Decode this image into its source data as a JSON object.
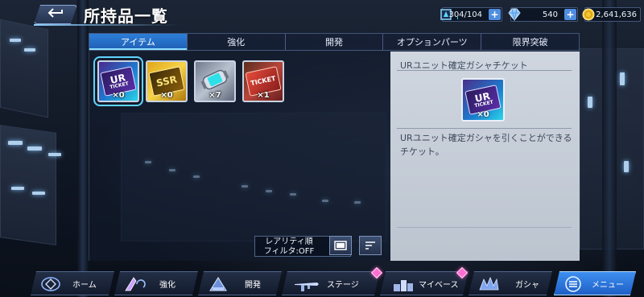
{
  "header": {
    "title": "所持品一覧",
    "back_icon": "back-arrow-icon",
    "resources": [
      {
        "name": "stamina",
        "value": "304/104",
        "icon": "stamina-icon",
        "color": "#33d7ff"
      },
      {
        "name": "gems",
        "value": "540",
        "icon": "gem-icon"
      },
      {
        "name": "coins",
        "value": "2,641,636",
        "icon": "coin-icon",
        "color": "#f4c430"
      }
    ],
    "plus_label": "+"
  },
  "tabs": [
    {
      "label": "アイテム",
      "active": true
    },
    {
      "label": "強化",
      "active": false
    },
    {
      "label": "開発",
      "active": false
    },
    {
      "label": "オプションパーツ",
      "active": false
    },
    {
      "label": "限界突破",
      "active": false
    }
  ],
  "items": [
    {
      "name": "ur-gacha-ticket",
      "count": "×0",
      "icon": "ur-ticket-icon",
      "ticket_top": "UR",
      "ticket_bottom": "TICKET",
      "selected": true
    },
    {
      "name": "ssr-gacha-ticket",
      "count": "×0",
      "icon": "ssr-ticket-icon",
      "ticket_top": "SSR",
      "ticket_bottom": "",
      "selected": false
    },
    {
      "name": "energy-canister",
      "count": "×7",
      "icon": "canister-icon",
      "selected": false
    },
    {
      "name": "gacha-ticket",
      "count": "×1",
      "icon": "ticket-icon",
      "ticket_top": "TICKET",
      "ticket_bottom": "",
      "selected": false
    }
  ],
  "sort": {
    "order_label": "レアリティ順",
    "filter_label": "フィルタ:OFF"
  },
  "detail": {
    "title": "URユニット確定ガシャチケット",
    "count": "×0",
    "ticket_top": "UR",
    "ticket_bottom": "TICKET",
    "description": "URユニット確定ガシャを引くことができるチケット。"
  },
  "bottom_nav": [
    {
      "label": "ホーム",
      "icon": "home-icon"
    },
    {
      "label": "強化",
      "icon": "upgrade-icon"
    },
    {
      "label": "開発",
      "icon": "develop-icon"
    },
    {
      "label": "ステージ",
      "icon": "stage-icon",
      "badge": true
    },
    {
      "label": "マイベース",
      "icon": "base-icon",
      "badge": true
    },
    {
      "label": "ガシャ",
      "icon": "gacha-icon"
    },
    {
      "label": "メニュー",
      "icon": "menu-icon"
    }
  ]
}
